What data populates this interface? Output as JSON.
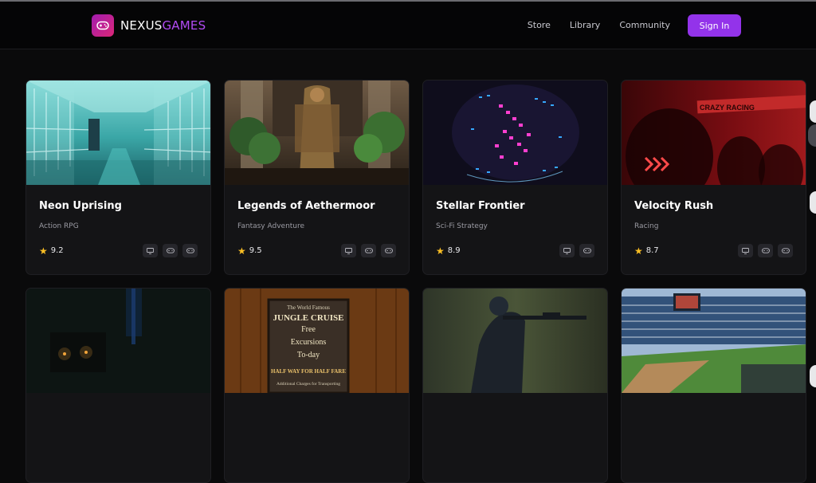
{
  "brand": {
    "name_part1": "NEXUS",
    "name_part2": "GAMES",
    "accent": "#9333ea"
  },
  "nav": {
    "links": [
      "Store",
      "Library",
      "Community"
    ],
    "signin_label": "Sign In"
  },
  "games": [
    {
      "title": "Neon Uprising",
      "genre": "Action RPG",
      "rating": "9.2",
      "platforms": [
        "desktop-icon",
        "gamepad-icon",
        "gamepad-icon"
      ]
    },
    {
      "title": "Legends of Aethermoor",
      "genre": "Fantasy Adventure",
      "rating": "9.5",
      "platforms": [
        "desktop-icon",
        "gamepad-icon",
        "gamepad-icon"
      ]
    },
    {
      "title": "Stellar Frontier",
      "genre": "Sci-Fi Strategy",
      "rating": "8.9",
      "platforms": [
        "desktop-icon",
        "gamepad-icon"
      ]
    },
    {
      "title": "Velocity Rush",
      "genre": "Racing",
      "rating": "8.7",
      "platforms": [
        "desktop-icon",
        "gamepad-icon",
        "gamepad-icon"
      ]
    }
  ],
  "second_row": {
    "sign_lines": [
      "The World Famous",
      "JUNGLE CRUISE",
      "Free",
      "Excursions",
      "To-day",
      "HALF WAY FOR HALF FARE",
      "Additional Charges for Transporting"
    ],
    "banner_text": "CRAZY RACING"
  }
}
